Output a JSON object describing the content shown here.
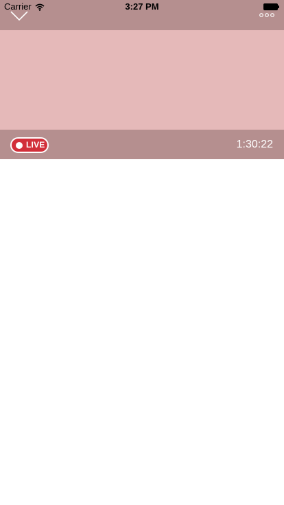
{
  "status_bar": {
    "carrier": "Carrier",
    "time": "3:27 PM",
    "wifi_icon": "wifi-icon",
    "battery_icon": "battery-full-icon"
  },
  "header": {
    "collapse_icon": "chevron-down-icon",
    "more_icon": "more-dots-icon"
  },
  "player": {
    "live_label": "LIVE",
    "elapsed_time": "1:30:22"
  },
  "colors": {
    "bar_background": "#b58f8f",
    "video_background": "#e5b9b9",
    "live_badge": "#d22f3a",
    "page_background": "#ffffff"
  }
}
